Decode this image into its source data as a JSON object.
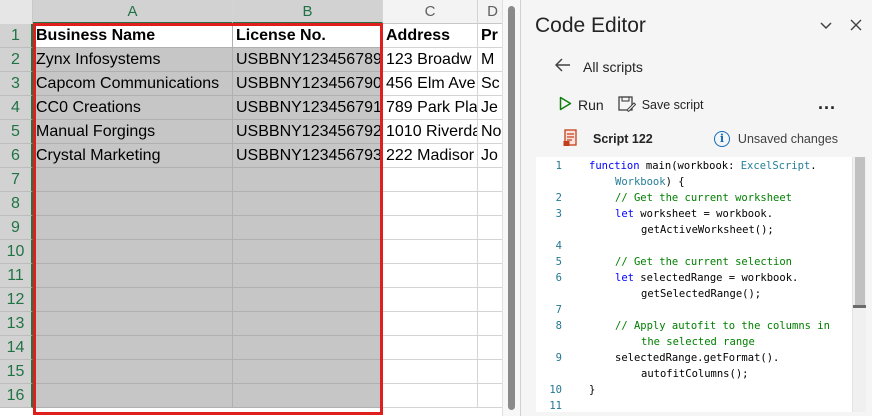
{
  "sheet": {
    "columns": [
      "A",
      "B",
      "C",
      "D"
    ],
    "rows": [
      "1",
      "2",
      "3",
      "4",
      "5",
      "6",
      "7",
      "8",
      "9",
      "10",
      "11",
      "12",
      "13",
      "14",
      "15",
      "16"
    ],
    "header": [
      "Business Name",
      "License No.",
      "Address",
      "Pr"
    ],
    "data": [
      [
        "Zynx Infosystems",
        "USBBNY123456789",
        "123 Broadw",
        "M"
      ],
      [
        "Capcom Communications",
        "USBBNY123456790",
        "456 Elm Ave",
        "Sc"
      ],
      [
        "CC0 Creations",
        "USBBNY123456791",
        "789 Park Pla",
        "Je"
      ],
      [
        "Manual Forgings",
        "USBBNY123456792",
        "1010 Riverda",
        "No"
      ],
      [
        "Crystal Marketing",
        "USBBNY123456793",
        "222 Madisor",
        "Jo"
      ]
    ],
    "selection_color": "#e01e1e",
    "accent": "#217346"
  },
  "editor": {
    "title": "Code Editor",
    "chevron_icon": "chevron-down-icon",
    "close_icon": "close-icon",
    "back_label": "All scripts",
    "run_label": "Run",
    "save_label": "Save script",
    "more_label": "...",
    "script_name": "Script 122",
    "status": "Unsaved changes",
    "code": [
      {
        "n": "1",
        "parts": [
          [
            "kw",
            "function "
          ],
          [
            "fn",
            "main(workbook: "
          ],
          [
            "ty",
            "ExcelScript"
          ],
          [
            "fn",
            "."
          ]
        ]
      },
      {
        "n": "",
        "parts": [
          [
            "ty",
            "Workbook"
          ],
          [
            "fn",
            ") {"
          ]
        ],
        "indent": 1
      },
      {
        "n": "2",
        "parts": [
          [
            "cm",
            "// Get the current worksheet"
          ]
        ],
        "indent": 1
      },
      {
        "n": "3",
        "parts": [
          [
            "kw",
            "let "
          ],
          [
            "fn",
            "worksheet = workbook."
          ]
        ],
        "indent": 1
      },
      {
        "n": "",
        "parts": [
          [
            "fn",
            "getActiveWorksheet();"
          ]
        ],
        "indent": 2
      },
      {
        "n": "4",
        "parts": []
      },
      {
        "n": "5",
        "parts": [
          [
            "cm",
            "// Get the current selection"
          ]
        ],
        "indent": 1
      },
      {
        "n": "6",
        "parts": [
          [
            "kw",
            "let "
          ],
          [
            "fn",
            "selectedRange = workbook."
          ]
        ],
        "indent": 1
      },
      {
        "n": "",
        "parts": [
          [
            "fn",
            "getSelectedRange();"
          ]
        ],
        "indent": 2
      },
      {
        "n": "7",
        "parts": []
      },
      {
        "n": "8",
        "parts": [
          [
            "cm",
            "// Apply autofit to the columns in"
          ]
        ],
        "indent": 1
      },
      {
        "n": "",
        "parts": [
          [
            "cm",
            "the selected range"
          ]
        ],
        "indent": 2
      },
      {
        "n": "9",
        "parts": [
          [
            "fn",
            "selectedRange.getFormat()."
          ]
        ],
        "indent": 1
      },
      {
        "n": "",
        "parts": [
          [
            "fn",
            "autofitColumns();"
          ]
        ],
        "indent": 2
      },
      {
        "n": "10",
        "parts": [
          [
            "fn",
            "}"
          ]
        ]
      },
      {
        "n": "11",
        "parts": []
      }
    ]
  }
}
